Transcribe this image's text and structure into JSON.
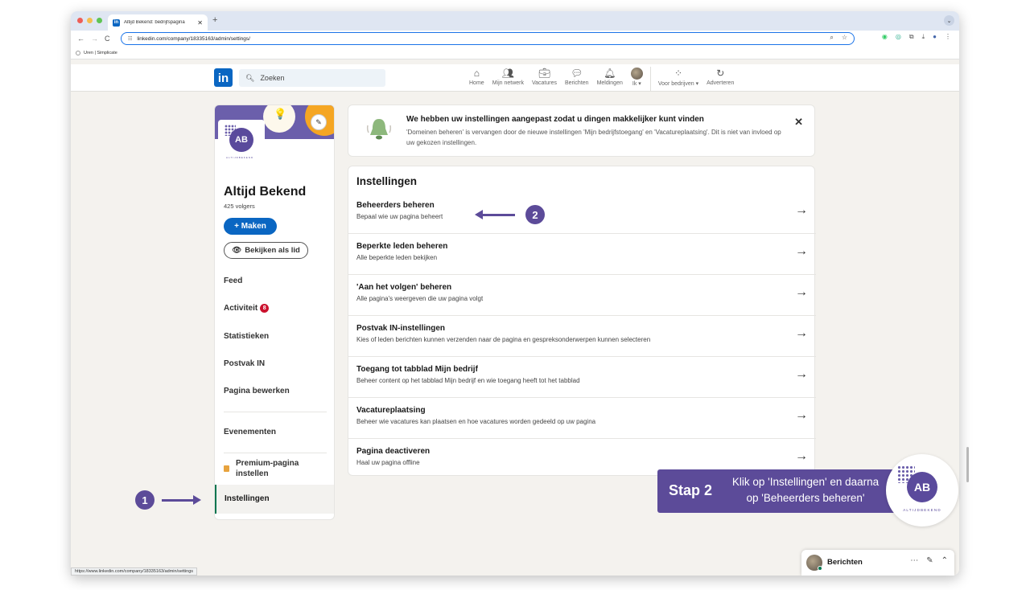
{
  "browser": {
    "tab_title": "Altijd Bekend: bedrijfspagina",
    "url": "linkedin.com/company/18335163/admin/settings/",
    "bookmark": "Uren | Simplicate",
    "status_url": "https://www.linkedin.com/company/18335163/admin/settings"
  },
  "header": {
    "logo": "in",
    "search_placeholder": "Zoeken",
    "nav": [
      {
        "label": "Home",
        "icon": "home-icon"
      },
      {
        "label": "Mijn netwerk",
        "icon": "network-icon"
      },
      {
        "label": "Vacatures",
        "icon": "briefcase-icon"
      },
      {
        "label": "Berichten",
        "icon": "messaging-icon"
      },
      {
        "label": "Meldingen",
        "icon": "bell-icon"
      },
      {
        "label": "Ik ▾",
        "icon": "avatar"
      },
      {
        "label": "Voor bedrijven ▾",
        "icon": "grid-icon"
      },
      {
        "label": "Adverteren",
        "icon": "advertise-icon"
      }
    ]
  },
  "sidebar": {
    "company_name": "Altijd Bekend",
    "followers": "425 volgers",
    "create_button": "+ Maken",
    "view_button": "Bekijken als lid",
    "logo_text": "AB",
    "logo_tagline": "ALTIJDBEKEND",
    "items": [
      {
        "label": "Feed"
      },
      {
        "label": "Activiteit",
        "badge": "8"
      },
      {
        "label": "Statistieken"
      },
      {
        "label": "Postvak IN"
      },
      {
        "label": "Pagina bewerken"
      },
      {
        "label": "Evenementen"
      }
    ],
    "premium_label": "Premium-pagina instellen",
    "settings_label": "Instellingen"
  },
  "notice": {
    "title": "We hebben uw instellingen aangepast zodat u dingen makkelijker kunt vinden",
    "body": "'Domeinen beheren' is vervangen door de nieuwe instellingen 'Mijn bedrijfstoegang' en 'Vacatureplaatsing'. Dit is niet van invloed op uw gekozen instellingen.",
    "close": "✕"
  },
  "settings": {
    "title": "Instellingen",
    "rows": [
      {
        "title": "Beheerders beheren",
        "desc": "Bepaal wie uw pagina beheert"
      },
      {
        "title": "Beperkte leden beheren",
        "desc": "Alle beperkte leden bekijken"
      },
      {
        "title": "'Aan het volgen' beheren",
        "desc": "Alle pagina's weergeven die uw pagina volgt"
      },
      {
        "title": "Postvak IN-instellingen",
        "desc": "Kies of leden berichten kunnen verzenden naar de pagina en gespreksonderwerpen kunnen selecteren"
      },
      {
        "title": "Toegang tot tabblad Mijn bedrijf",
        "desc": "Beheer content op het tabblad Mijn bedrijf en wie toegang heeft tot het tabblad"
      },
      {
        "title": "Vacatureplaatsing",
        "desc": "Beheer wie vacatures kan plaatsen en hoe vacatures worden gedeeld op uw pagina"
      },
      {
        "title": "Pagina deactiveren",
        "desc": "Haal uw pagina offline"
      }
    ]
  },
  "annotations": {
    "num1": "1",
    "num2": "2"
  },
  "step": {
    "label": "Stap 2",
    "text": "Klik op 'Instellingen' en daarna op 'Beheerders beheren'",
    "logo_text": "AB",
    "tagline": "ALTIJDBEKEND"
  },
  "messaging": {
    "label": "Berichten"
  },
  "colors": {
    "linkedin_blue": "#0a66c2",
    "annotation_purple": "#5c4b99",
    "badge_red": "#cb112d"
  }
}
